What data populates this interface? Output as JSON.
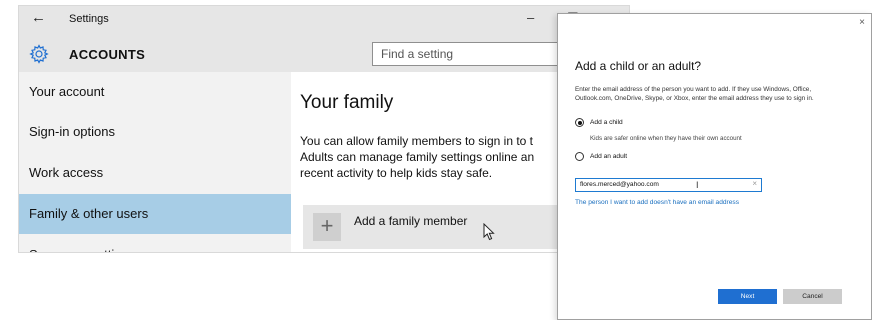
{
  "settings_window": {
    "app_title": "Settings",
    "back_glyph": "←",
    "controls": {
      "minimize": "–",
      "maximize": "☐",
      "close": "✕"
    },
    "section_title": "ACCOUNTS",
    "section_icon": "gear-icon",
    "search_placeholder": "Find a setting",
    "sidebar": {
      "items": [
        {
          "label": "Your account"
        },
        {
          "label": "Sign-in options"
        },
        {
          "label": "Work access"
        },
        {
          "label": "Family & other users",
          "active": true
        },
        {
          "label": "Sync your settings"
        }
      ]
    },
    "content": {
      "title": "Your family",
      "description_lines": [
        "You can allow family members to sign in to t",
        "Adults can manage family settings online an",
        "recent activity to help kids stay safe."
      ],
      "add_member": {
        "plus_glyph": "+",
        "label": "Add a family member"
      }
    }
  },
  "dialog": {
    "close_glyph": "×",
    "title": "Add a child or an adult?",
    "description_lines": [
      "Enter the email address of the person you want to add. If they use Windows, Office,",
      "Outlook.com, OneDrive, Skype, or Xbox, enter the email address they use to sign in."
    ],
    "options": {
      "child": {
        "label": "Add a child",
        "selected": true,
        "note": "Kids are safer online when they have their own account"
      },
      "adult": {
        "label": "Add an adult",
        "selected": false
      }
    },
    "email": {
      "value": "flores.merced@yahoo.com",
      "clear_glyph": "×",
      "cursor_glyph": "I"
    },
    "no_email_link": "The person I want to add doesn't have an email address",
    "buttons": {
      "next": "Next",
      "cancel": "Cancel"
    },
    "colors": {
      "primary": "#1f6fd1",
      "link": "#1a6fbf",
      "field_border": "#1e7ad1"
    }
  },
  "colors": {
    "active_nav": "#a7cde6",
    "titlebar": "#e6e6e6",
    "sidebar": "#f2f2f2"
  }
}
